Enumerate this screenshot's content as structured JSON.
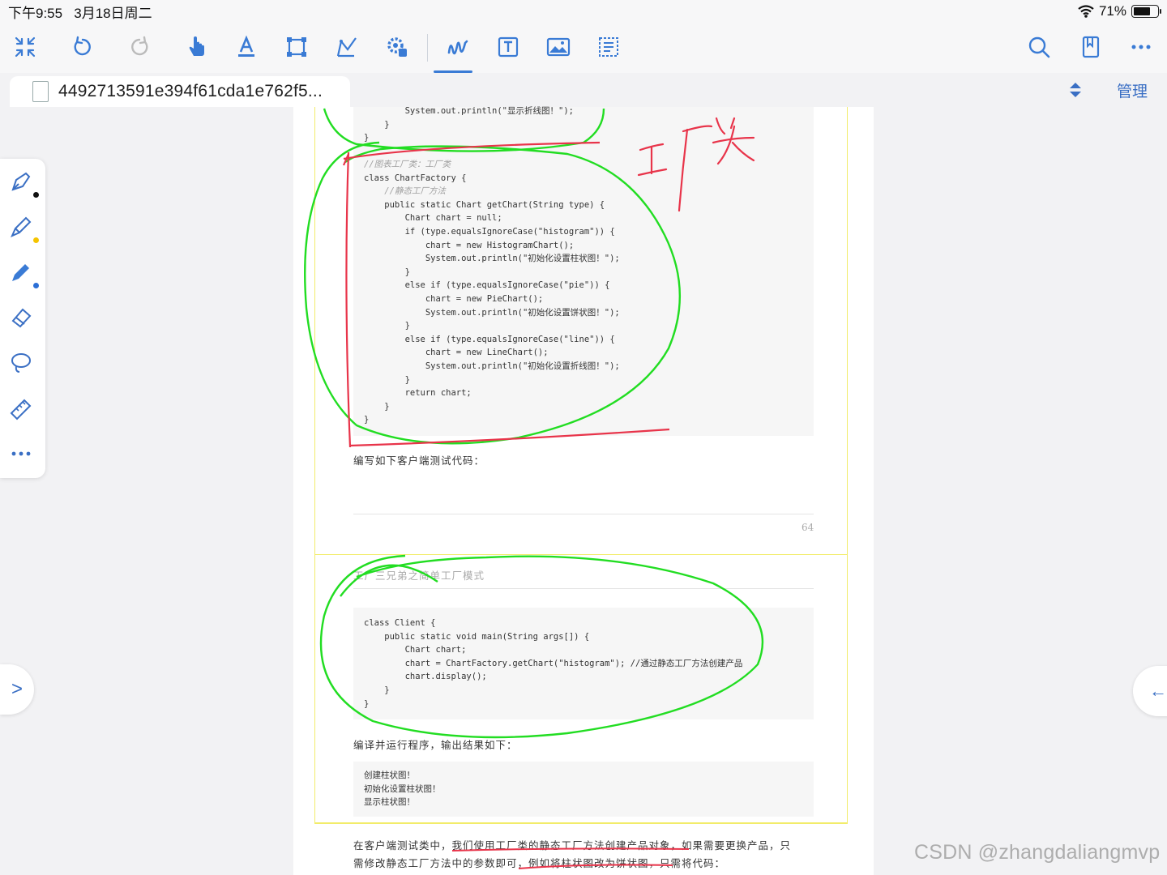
{
  "status": {
    "time": "下午9:55",
    "date": "3月18日周二",
    "battery": "71%",
    "battery_level": 0.71
  },
  "toolbar": {
    "tools": [
      "collapse-icon",
      "undo-icon",
      "redo-icon",
      "hand-pointer-icon",
      "text-underline-icon",
      "select-rect-icon",
      "shape-icon",
      "settings-gear-icon",
      "handwriting-icon",
      "textbox-icon",
      "image-icon",
      "text-recognition-icon"
    ],
    "active_tool": "handwriting-icon",
    "right_tools": [
      "search-icon",
      "bookmark-icon",
      "more-icon"
    ]
  },
  "tab": {
    "title": "4492713591e394f61cda1e762f5...",
    "manage_label": "管理"
  },
  "pen_panel": [
    "pen-icon",
    "highlighter-icon",
    "marker-icon",
    "eraser-icon",
    "lasso-icon",
    "ruler-icon",
    "more-dots-icon"
  ],
  "pen_colors": {
    "pen": "#111111",
    "highlighter": "#f5c400",
    "marker": "#2b6fd6"
  },
  "nav": {
    "left": ">",
    "right": "←"
  },
  "document": {
    "code_top": [
      "        System.out.println(\"显示折线图！\");",
      "    }",
      "}"
    ],
    "factory_code_lines": [
      "//图表工厂类：工厂类",
      "class ChartFactory {",
      "    //静态工厂方法",
      "    public static Chart getChart(String type) {",
      "        Chart chart = null;",
      "        if (type.equalsIgnoreCase(\"histogram\")) {",
      "            chart = new HistogramChart();",
      "            System.out.println(\"初始化设置柱状图！\");",
      "        }",
      "        else if (type.equalsIgnoreCase(\"pie\")) {",
      "            chart = new PieChart();",
      "            System.out.println(\"初始化设置饼状图！\");",
      "        }",
      "        else if (type.equalsIgnoreCase(\"line\")) {",
      "            chart = new LineChart();",
      "            System.out.println(\"初始化设置折线图！\");",
      "        }",
      "        return chart;",
      "    }",
      "}"
    ],
    "para1": "编写如下客户端测试代码：",
    "page_number": "64",
    "header_title": "工厂三兄弟之简单工厂模式",
    "client_code_lines": [
      "class Client {",
      "    public static void main(String args[]) {",
      "        Chart chart;",
      "        chart = ChartFactory.getChart(\"histogram\"); //通过静态工厂方法创建产品",
      "        chart.display();",
      "    }",
      "}"
    ],
    "para2": "编译并运行程序，输出结果如下：",
    "output_lines": [
      "创建柱状图！",
      "初始化设置柱状图！",
      "显示柱状图！"
    ],
    "para3_line1": "在客户端测试类中，我们使用工厂类的静态工厂方法创建产品对象，如果需要更换产品，只",
    "para3_line2": "需修改静态工厂方法中的参数即可，例如将柱状图改为饼状图，只需将代码："
  },
  "annotation_text": "工厂类",
  "watermark": "CSDN @zhangdaliangmvp"
}
